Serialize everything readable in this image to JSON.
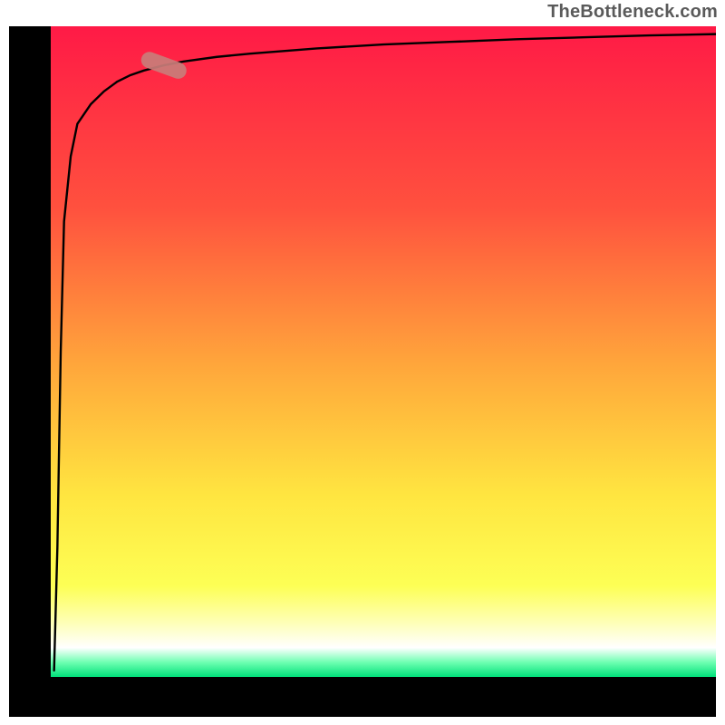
{
  "attribution": "TheBottleneck.com",
  "chart_data": {
    "type": "line",
    "title": "",
    "xlabel": "",
    "ylabel": "",
    "xlim": [
      0,
      100
    ],
    "ylim": [
      0,
      100
    ],
    "x": [
      0.5,
      1,
      1.5,
      2,
      3,
      4,
      6,
      8,
      10,
      12,
      14,
      17,
      20,
      25,
      30,
      40,
      50,
      60,
      70,
      80,
      90,
      100
    ],
    "values": [
      1,
      20,
      50,
      70,
      80,
      85,
      88,
      90,
      91.5,
      92.5,
      93.2,
      94,
      94.6,
      95.3,
      95.8,
      96.6,
      97.2,
      97.6,
      98,
      98.3,
      98.6,
      98.8
    ],
    "marker": {
      "x": 17,
      "y": 94,
      "angle_deg": 20
    },
    "gradient_stops": [
      {
        "offset": 0.0,
        "color": "#ff1a46"
      },
      {
        "offset": 0.28,
        "color": "#ff513e"
      },
      {
        "offset": 0.52,
        "color": "#ffa63b"
      },
      {
        "offset": 0.72,
        "color": "#ffe540"
      },
      {
        "offset": 0.86,
        "color": "#fdff55"
      },
      {
        "offset": 0.915,
        "color": "#feffb4"
      },
      {
        "offset": 0.955,
        "color": "#ffffff"
      },
      {
        "offset": 0.978,
        "color": "#6bffb0"
      },
      {
        "offset": 1.0,
        "color": "#00e07a"
      }
    ]
  }
}
